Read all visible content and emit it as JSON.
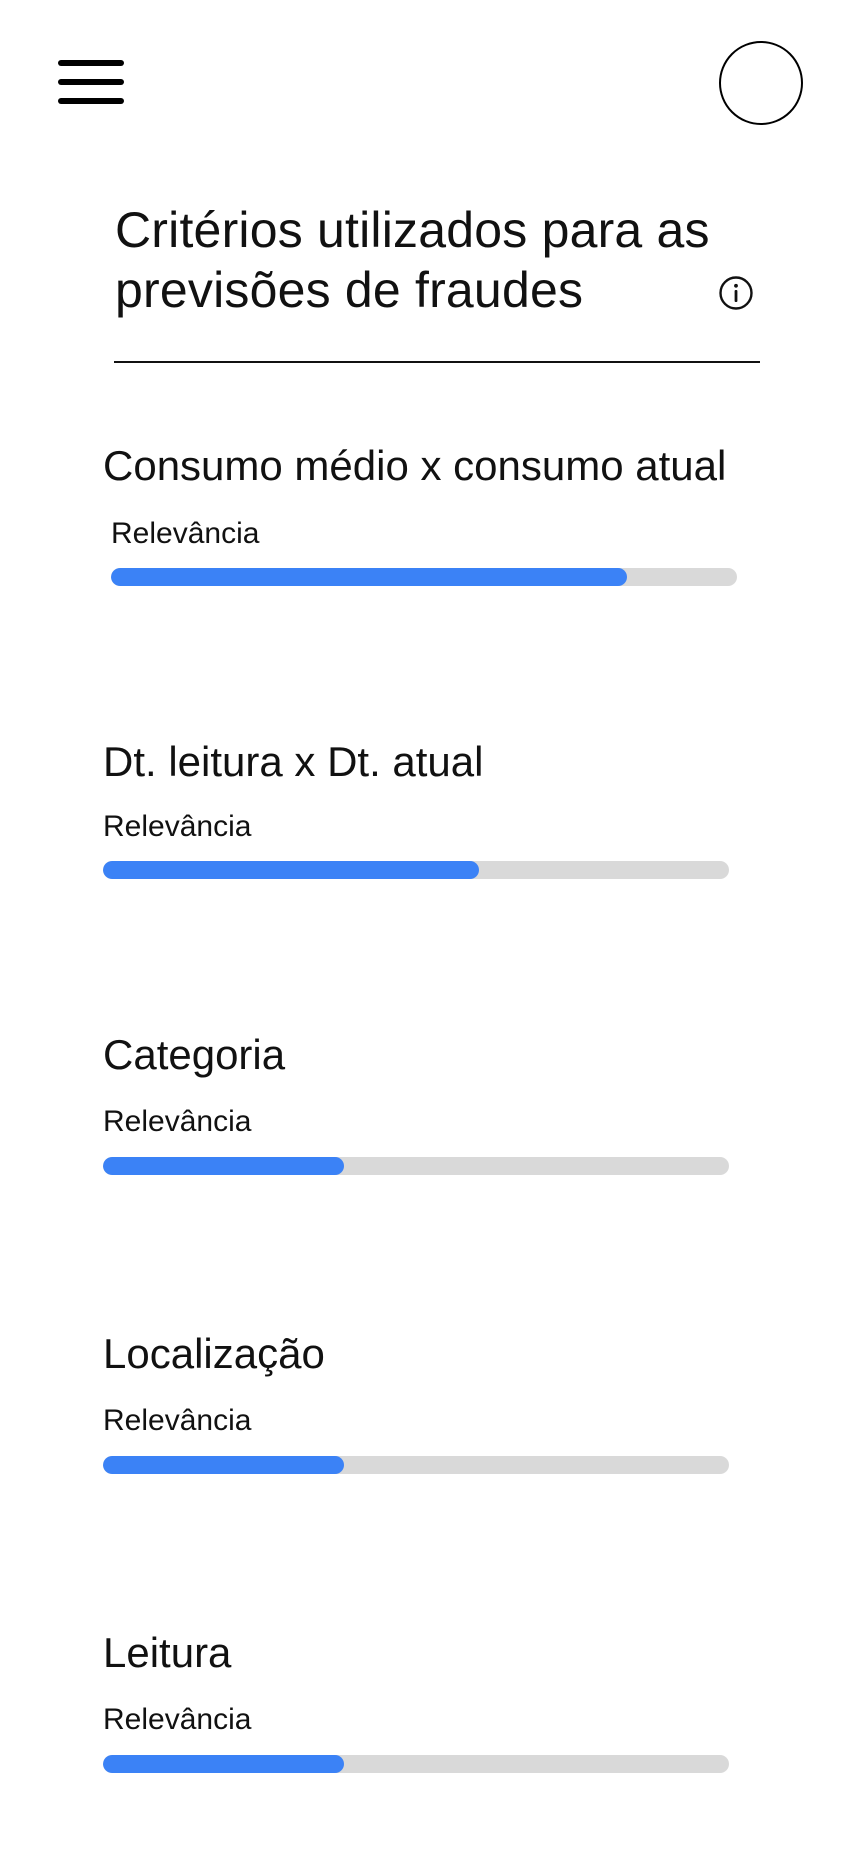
{
  "header": {
    "menu_icon": "hamburger-menu-icon",
    "avatar_icon": "user-avatar-circle"
  },
  "title": {
    "line1": "Critérios utilizados para as",
    "line2": "previsões de fraudes",
    "info_icon": "info-icon"
  },
  "colors": {
    "accent": "#3b82f6",
    "track": "#d9d9d9",
    "text": "#111111"
  },
  "criteria": [
    {
      "name": "Consumo médio x consumo atual",
      "relevance_label": "Relevância",
      "relevance": 0.825
    },
    {
      "name": "Dt. leitura x Dt. atual",
      "relevance_label": "Relevância",
      "relevance": 0.6
    },
    {
      "name": "Categoria",
      "relevance_label": "Relevância",
      "relevance": 0.385
    },
    {
      "name": "Localização",
      "relevance_label": "Relevância",
      "relevance": 0.385
    },
    {
      "name": "Leitura",
      "relevance_label": "Relevância",
      "relevance": 0.385
    }
  ]
}
